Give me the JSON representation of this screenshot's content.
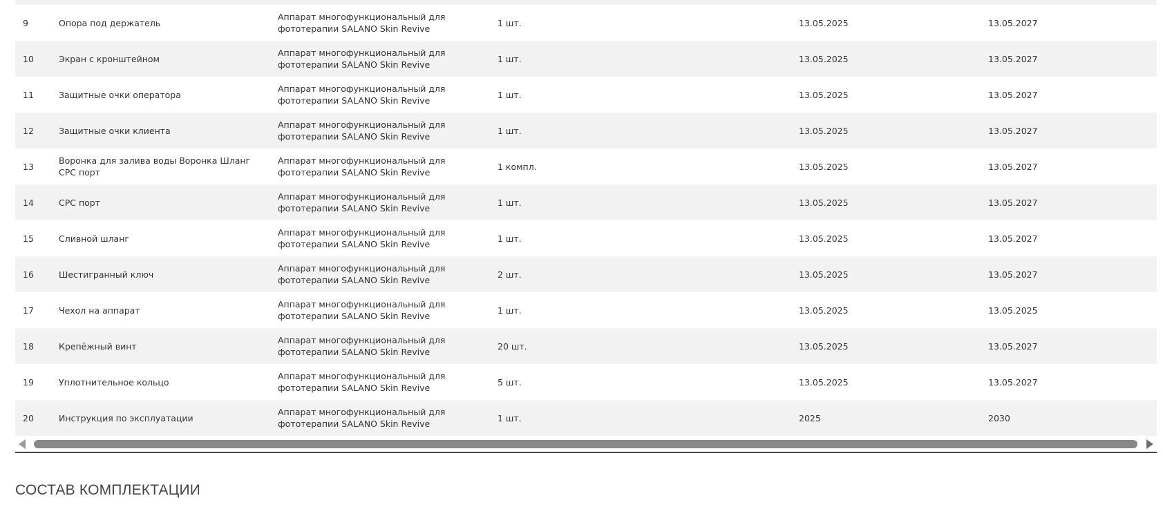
{
  "table": {
    "rows": [
      {
        "num": "9",
        "name": "Опора под держатель",
        "device_line1": "Аппарат многофункциональный для",
        "device_line2": "фототерапии SALANO Skin Revive",
        "qty": "1 шт.",
        "date_start": "13.05.2025",
        "date_end": "13.05.2027"
      },
      {
        "num": "10",
        "name": "Экран с кронштейном",
        "device_line1": "Аппарат многофункциональный для",
        "device_line2": "фототерапии SALANO Skin Revive",
        "qty": "1 шт.",
        "date_start": "13.05.2025",
        "date_end": "13.05.2027"
      },
      {
        "num": "11",
        "name": "Защитные очки оператора",
        "device_line1": "Аппарат многофункциональный для",
        "device_line2": "фототерапии SALANO Skin Revive",
        "qty": "1 шт.",
        "date_start": "13.05.2025",
        "date_end": "13.05.2027"
      },
      {
        "num": "12",
        "name": "Защитные очки клиента",
        "device_line1": "Аппарат многофункциональный для",
        "device_line2": "фототерапии SALANO Skin Revive",
        "qty": "1 шт.",
        "date_start": "13.05.2025",
        "date_end": "13.05.2027"
      },
      {
        "num": "13",
        "name": "Воронка для залива воды Воронка Шланг СРС порт",
        "device_line1": "Аппарат многофункциональный для",
        "device_line2": "фототерапии SALANO Skin Revive",
        "qty": "1 компл.",
        "date_start": "13.05.2025",
        "date_end": "13.05.2027"
      },
      {
        "num": "14",
        "name": "СРС порт",
        "device_line1": "Аппарат многофункциональный для",
        "device_line2": "фототерапии SALANO Skin Revive",
        "qty": "1 шт.",
        "date_start": "13.05.2025",
        "date_end": "13.05.2027"
      },
      {
        "num": "15",
        "name": "Сливной шланг",
        "device_line1": "Аппарат многофункциональный для",
        "device_line2": "фототерапии SALANO Skin Revive",
        "qty": "1 шт.",
        "date_start": "13.05.2025",
        "date_end": "13.05.2027"
      },
      {
        "num": "16",
        "name": "Шестигранный ключ",
        "device_line1": "Аппарат многофункциональный для",
        "device_line2": "фототерапии SALANO Skin Revive",
        "qty": "2 шт.",
        "date_start": "13.05.2025",
        "date_end": "13.05.2027"
      },
      {
        "num": "17",
        "name": "Чехол на аппарат",
        "device_line1": "Аппарат многофункциональный для",
        "device_line2": "фототерапии SALANO Skin Revive",
        "qty": "1 шт.",
        "date_start": "13.05.2025",
        "date_end": "13.05.2025"
      },
      {
        "num": "18",
        "name": "Крепёжный винт",
        "device_line1": "Аппарат многофункциональный для",
        "device_line2": "фототерапии SALANO Skin Revive",
        "qty": "20 шт.",
        "date_start": "13.05.2025",
        "date_end": "13.05.2027"
      },
      {
        "num": "19",
        "name": "Уплотнительное кольцо",
        "device_line1": "Аппарат многофункциональный для",
        "device_line2": "фототерапии SALANO Skin Revive",
        "qty": "5 шт.",
        "date_start": "13.05.2025",
        "date_end": "13.05.2027"
      },
      {
        "num": "20",
        "name": "Инструкция по эксплуатации",
        "device_line1": "Аппарат многофункциональный для",
        "device_line2": "фототерапии SALANO Skin Revive",
        "qty": "1 шт.",
        "date_start": "2025",
        "date_end": "2030"
      }
    ]
  },
  "section": {
    "title": "СОСТАВ КОМПЛЕКТАЦИИ"
  },
  "colors": {
    "row_alt": "#f2f2f2",
    "row_base": "#ffffff",
    "text": "#333333",
    "scrollbar_thumb": "#888888"
  }
}
